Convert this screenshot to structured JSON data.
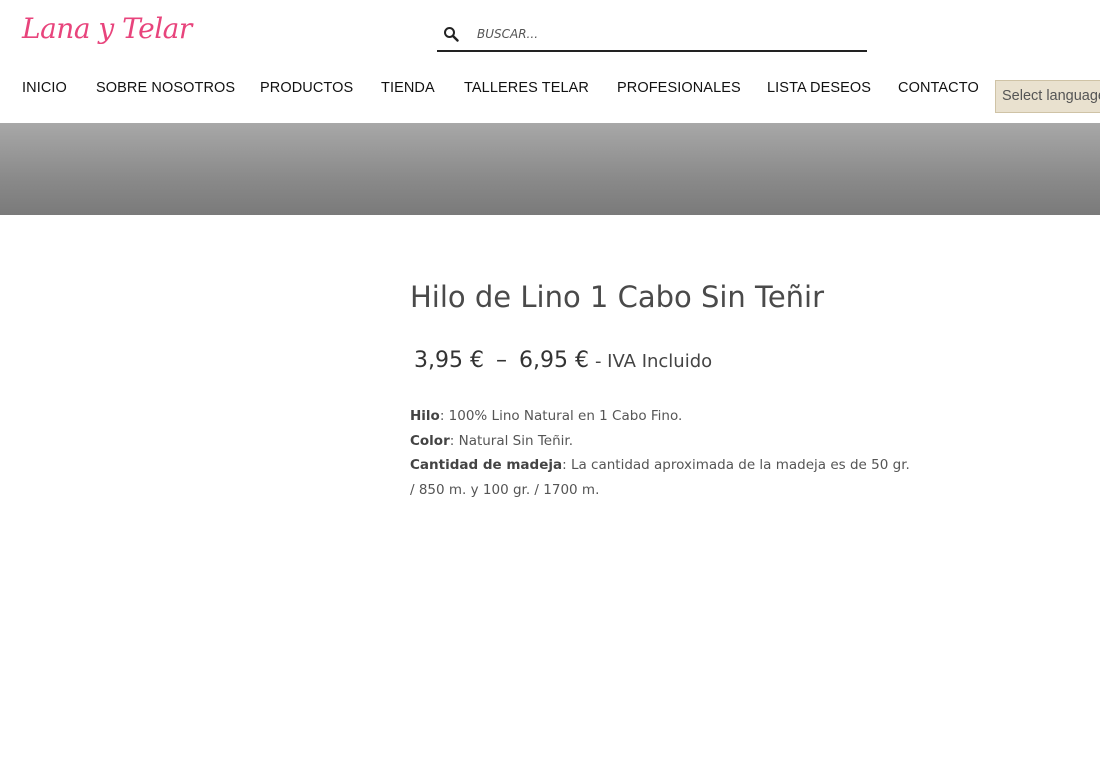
{
  "logo": {
    "text": "Lana y Telar"
  },
  "search": {
    "placeholder": "BUSCAR..."
  },
  "nav": {
    "items": [
      "INICIO",
      "SOBRE NOSOTROS",
      "PRODUCTOS",
      "TIENDA",
      "TALLERES TELAR",
      "PROFESIONALES",
      "LISTA DESEOS",
      "CONTACTO"
    ],
    "language_select": "Select language"
  },
  "product": {
    "title": "Hilo de Lino 1 Cabo Sin Teñir",
    "price_min": "3,95 €",
    "price_separator": "–",
    "price_max": "6,95 €",
    "price_suffix": "- IVA Incluido",
    "details": [
      {
        "label": "Hilo",
        "value": ": 100% Lino Natural en 1 Cabo Fino."
      },
      {
        "label": "Color",
        "value": ": Natural Sin Teñir."
      },
      {
        "label": "Cantidad de madeja",
        "value": ": La cantidad aproximada de la madeja es de 50 gr. / 850 m. y 100 gr. / 1700 m."
      }
    ]
  },
  "colors": {
    "brand_pink": "#e8447c",
    "banner_gray": "#8a8a8a",
    "lang_select_bg": "#e9e1cf"
  },
  "icons": {
    "search": "search-icon"
  }
}
